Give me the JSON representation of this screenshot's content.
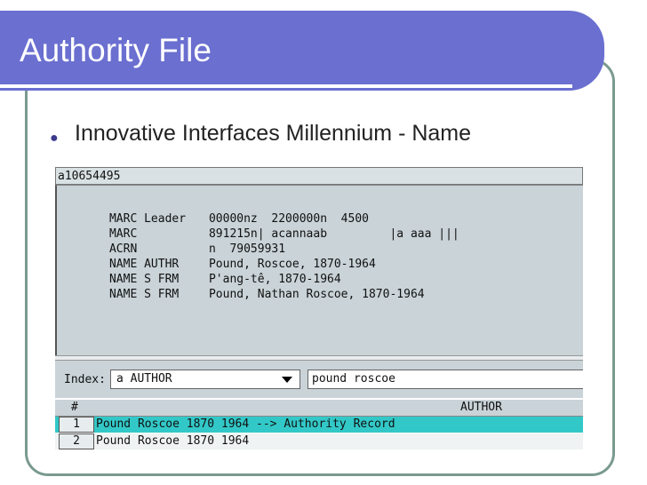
{
  "slide": {
    "title": "Authority File",
    "bullet": "Innovative Interfaces Millennium - Name"
  },
  "app": {
    "record_id": "a10654495",
    "fields": [
      {
        "label": "MARC Leader",
        "value": "00000nz  2200000n  4500"
      },
      {
        "label": "MARC",
        "value": "891215n| acannaab         |a aaa |||"
      },
      {
        "label": "ACRN",
        "value": "n  79059931"
      },
      {
        "label": "NAME AUTHR",
        "value": "Pound, Roscoe, 1870-1964"
      },
      {
        "label": "NAME S FRM",
        "value": "P'ang-tê, 1870-1964"
      },
      {
        "label": "NAME S FRM",
        "value": "Pound, Nathan Roscoe, 1870-1964"
      }
    ],
    "index_label": "Index:",
    "index_value": "a AUTHOR",
    "search_value": "pound roscoe",
    "results_header": {
      "num": "#",
      "author": "AUTHOR"
    },
    "results": [
      {
        "num": "1",
        "text": "Pound Roscoe 1870 1964 --> Authority Record",
        "selected": true
      },
      {
        "num": "2",
        "text": "Pound Roscoe 1870 1964",
        "selected": false
      }
    ]
  },
  "colors": {
    "title_bar": "#6a6fd0",
    "frame": "#7a9a8e",
    "panel": "#c9d3d8",
    "selected_row": "#33c8c8"
  }
}
